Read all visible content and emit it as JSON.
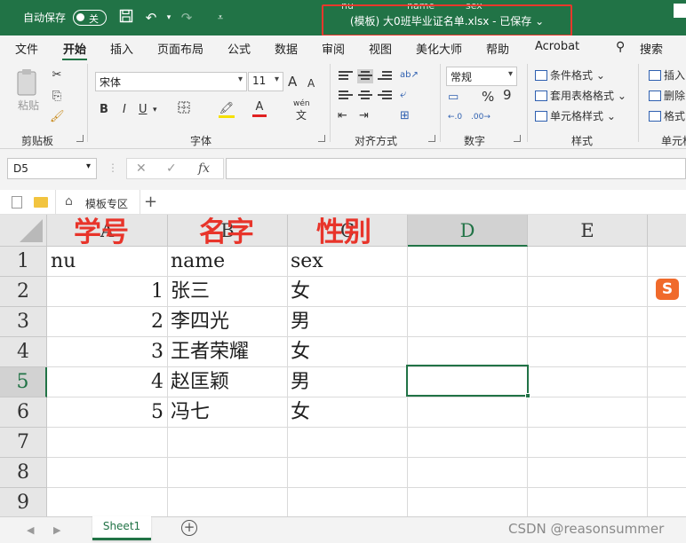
{
  "titlebar": {
    "autosave_label": "自动保存",
    "autosave_state": "关",
    "title": "(模板) 大0班毕业证名单.xlsx - 已保存 ⌄",
    "ghost_left": "nu",
    "ghost_mid": "name",
    "ghost_right": "sex"
  },
  "menu": {
    "tabs": [
      "文件",
      "开始",
      "插入",
      "页面布局",
      "公式",
      "数据",
      "审阅",
      "视图",
      "美化大师",
      "帮助",
      "Acrobat"
    ],
    "active": "开始",
    "search": "搜索"
  },
  "ribbon": {
    "clipboard": {
      "label": "剪贴板",
      "paste": "粘贴"
    },
    "font": {
      "label": "字体",
      "name": "宋体",
      "size": "11",
      "bold": "B",
      "italic": "I",
      "underline": "U",
      "grow": "A",
      "shrink": "A",
      "phonetic": "wén"
    },
    "alignment": {
      "label": "对齐方式"
    },
    "number": {
      "label": "数字",
      "format": "常规",
      "percent": "%",
      "comma": "9"
    },
    "styles": {
      "label": "样式",
      "conditional": "条件格式",
      "table": "套用表格格式",
      "cell": "单元格样式"
    },
    "cells": {
      "label": "单元格",
      "insert": "插入",
      "delete": "删除",
      "format": "格式"
    }
  },
  "formula_bar": {
    "name_box": "D5",
    "fx": "fx",
    "formula": ""
  },
  "doc_tabs": {
    "template_tab": "模板专区",
    "add": "+"
  },
  "grid": {
    "columns": [
      "A",
      "B",
      "C",
      "D",
      "E"
    ],
    "selected_column": "D",
    "rows": [
      "1",
      "2",
      "3",
      "4",
      "5",
      "6",
      "7",
      "8",
      "9"
    ],
    "selected_row": "5",
    "annotations": [
      "学号",
      "名字",
      "性别"
    ],
    "data": [
      {
        "a": "nu",
        "b": "name",
        "c": "sex"
      },
      {
        "a": "1",
        "b": "张三",
        "c": "女"
      },
      {
        "a": "2",
        "b": "李四光",
        "c": "男"
      },
      {
        "a": "3",
        "b": "王者荣耀",
        "c": "女"
      },
      {
        "a": "4",
        "b": "赵匡颖",
        "c": "男"
      },
      {
        "a": "5",
        "b": "冯七",
        "c": "女"
      }
    ]
  },
  "sheets": {
    "active": "Sheet1",
    "add": "+"
  },
  "watermark": "CSDN @reasonsummer",
  "colors": {
    "excel_green": "#217346",
    "annotation_red": "#e8342a"
  }
}
